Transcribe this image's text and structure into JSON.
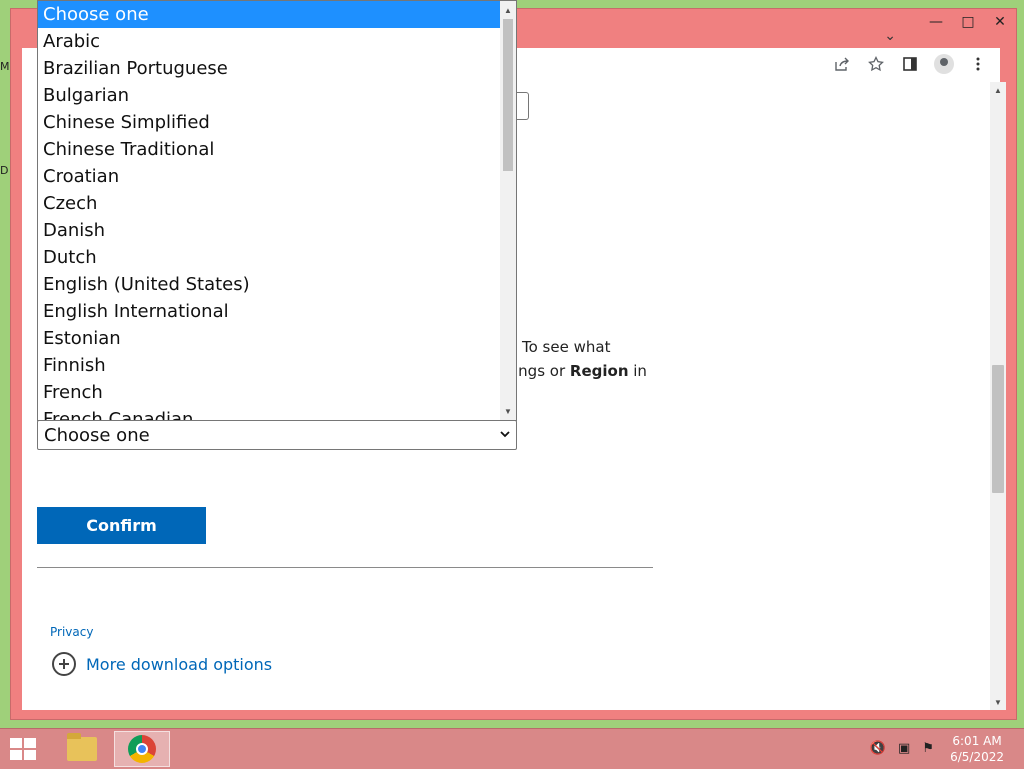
{
  "desktop": {
    "label_1": "M",
    "label_2": "D"
  },
  "window": {
    "controls": {
      "minimize": "—",
      "maximize": "□",
      "close": "✕"
    },
    "tab_strip_chevron": "⌄"
  },
  "toolbar": {
    "icons": [
      "share-icon",
      "star-icon",
      "side-panel-icon",
      "profile-icon",
      "menu-icon"
    ]
  },
  "page": {
    "text_line_1": "To see what",
    "text_line_2_prefix": "ings or ",
    "text_line_2_bold": "Region",
    "text_line_2_suffix": " in",
    "language_select_value": "Choose one",
    "confirm_label": "Confirm",
    "privacy_label": "Privacy",
    "more_options_label": "More download options"
  },
  "dropdown": {
    "selected_index": 0,
    "options": [
      "Choose one",
      "Arabic",
      "Brazilian Portuguese",
      "Bulgarian",
      "Chinese Simplified",
      "Chinese Traditional",
      "Croatian",
      "Czech",
      "Danish",
      "Dutch",
      "English (United States)",
      "English International",
      "Estonian",
      "Finnish",
      "French",
      "French Canadian"
    ]
  },
  "taskbar": {
    "time": "6:01 AM",
    "date": "6/5/2022"
  },
  "colors": {
    "accent": "#0067b8",
    "selection": "#1e90ff",
    "window_frame": "#f08080",
    "desktop": "#9fd07a"
  }
}
